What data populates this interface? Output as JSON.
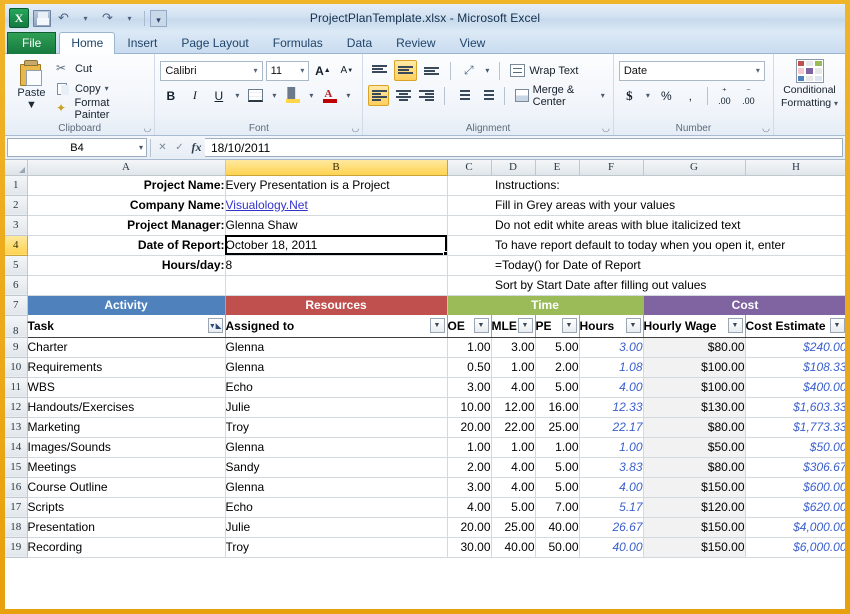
{
  "window": {
    "title": "ProjectPlanTemplate.xlsx - Microsoft Excel"
  },
  "quick_access": {
    "logo": "excel-logo",
    "items": [
      {
        "name": "save-icon",
        "label": "Save"
      },
      {
        "name": "undo-icon",
        "label": "↶"
      },
      {
        "name": "redo-icon",
        "label": "↷"
      },
      {
        "name": "customize-qat-icon",
        "label": "▼"
      }
    ]
  },
  "ribbon": {
    "tabs": [
      {
        "label": "File",
        "active": false,
        "file": true
      },
      {
        "label": "Home",
        "active": true
      },
      {
        "label": "Insert",
        "active": false
      },
      {
        "label": "Page Layout",
        "active": false
      },
      {
        "label": "Formulas",
        "active": false
      },
      {
        "label": "Data",
        "active": false
      },
      {
        "label": "Review",
        "active": false
      },
      {
        "label": "View",
        "active": false
      }
    ],
    "clipboard": {
      "group_label": "Clipboard",
      "paste": "Paste",
      "paste_caret": "▼",
      "cut": "Cut",
      "copy": "Copy",
      "format_painter": "Format Painter"
    },
    "font": {
      "group_label": "Font",
      "family": "Calibri",
      "size": "11",
      "grow": "A",
      "shrink": "A",
      "bold": "B",
      "italic": "I",
      "underline": "U",
      "borders": "Borders",
      "fill_color": "Fill Color",
      "font_color": "A",
      "caret": "▾"
    },
    "alignment": {
      "group_label": "Alignment",
      "top_align": "Top Align",
      "middle_align": "Middle Align",
      "bottom_align": "Bottom Align",
      "orientation": "Orientation",
      "wrap_text": "Wrap Text",
      "align_left": "Align Text Left",
      "align_center": "Center",
      "align_right": "Align Text Right",
      "decrease_indent": "Decrease Indent",
      "increase_indent": "Increase Indent",
      "merge_center": "Merge & Center",
      "caret": "▾"
    },
    "number": {
      "group_label": "Number",
      "format": "Date",
      "currency": "$",
      "percent": "%",
      "comma": ",",
      "increase_decimal": "Increase Decimal",
      "decrease_decimal": "Decrease Decimal",
      "caret": "▾"
    },
    "styles": {
      "conditional_formatting": "Conditional",
      "conditional_formatting2": "Formatting",
      "caret": "▾"
    }
  },
  "formula_bar": {
    "name_box": "B4",
    "caret": "▾",
    "cancel": "✕",
    "enter": "✓",
    "fx": "fx",
    "formula": "18/10/2011"
  },
  "grid": {
    "columns": [
      "A",
      "B",
      "C",
      "D",
      "E",
      "F",
      "G",
      "H"
    ],
    "selected_column": "B",
    "selected_row": "4",
    "selected_cell": "B4",
    "row_numbers": [
      "1",
      "2",
      "3",
      "4",
      "5",
      "6",
      "7",
      "8",
      "9",
      "10",
      "11",
      "12",
      "13",
      "14",
      "15",
      "16",
      "17",
      "18",
      "19"
    ]
  },
  "header_fields": [
    {
      "row": "1",
      "label": "Project Name:",
      "value": "Every Presentation is a Project",
      "style": "text"
    },
    {
      "row": "2",
      "label": "Company Name:",
      "value": "Visualology.Net",
      "style": "link"
    },
    {
      "row": "3",
      "label": "Project Manager:",
      "value": "Glenna Shaw",
      "style": "text"
    },
    {
      "row": "4",
      "label": "Date of Report:",
      "value": "October 18, 2011",
      "style": "selected"
    },
    {
      "row": "5",
      "label": "Hours/day:",
      "value": "8",
      "style": "text"
    }
  ],
  "instructions": {
    "title": "Instructions:",
    "lines": [
      "Fill in Grey areas with your values",
      "Do not edit white areas with blue italicized text",
      "To have report default to today when you open it, enter",
      "=Today() for Date of Report",
      "Sort by Start Date after filling out values"
    ]
  },
  "bands": [
    {
      "label": "Activity",
      "color": "#4F81BD",
      "key": "activity"
    },
    {
      "label": "Resources",
      "color": "#C0504D",
      "key": "resources"
    },
    {
      "label": "Time",
      "color": "#9BBB59",
      "key": "time"
    },
    {
      "label": "Cost",
      "color": "#8064A2",
      "key": "cost"
    }
  ],
  "table": {
    "headers": [
      {
        "label": "Task",
        "filter": "applied"
      },
      {
        "label": "Assigned to",
        "filter": "plain"
      },
      {
        "label": "OE",
        "filter": "plain"
      },
      {
        "label": "MLE",
        "filter": "plain"
      },
      {
        "label": "PE",
        "filter": "plain"
      },
      {
        "label": "Hours",
        "filter": "plain"
      },
      {
        "label": "Hourly Wage",
        "filter": "plain"
      },
      {
        "label": "Cost Estimate",
        "filter": "plain"
      }
    ],
    "rows": [
      {
        "row": "9",
        "task": "Charter",
        "assigned": "Glenna",
        "oe": "1.00",
        "mle": "3.00",
        "pe": "5.00",
        "hours": "3.00",
        "wage": "$80.00",
        "cost": "$240.00"
      },
      {
        "row": "10",
        "task": "Requirements",
        "assigned": "Glenna",
        "oe": "0.50",
        "mle": "1.00",
        "pe": "2.00",
        "hours": "1.08",
        "wage": "$100.00",
        "cost": "$108.33"
      },
      {
        "row": "11",
        "task": "WBS",
        "assigned": "Echo",
        "oe": "3.00",
        "mle": "4.00",
        "pe": "5.00",
        "hours": "4.00",
        "wage": "$100.00",
        "cost": "$400.00"
      },
      {
        "row": "12",
        "task": "Handouts/Exercises",
        "assigned": "Julie",
        "oe": "10.00",
        "mle": "12.00",
        "pe": "16.00",
        "hours": "12.33",
        "wage": "$130.00",
        "cost": "$1,603.33"
      },
      {
        "row": "13",
        "task": "Marketing",
        "assigned": "Troy",
        "oe": "20.00",
        "mle": "22.00",
        "pe": "25.00",
        "hours": "22.17",
        "wage": "$80.00",
        "cost": "$1,773.33"
      },
      {
        "row": "14",
        "task": "Images/Sounds",
        "assigned": "Glenna",
        "oe": "1.00",
        "mle": "1.00",
        "pe": "1.00",
        "hours": "1.00",
        "wage": "$50.00",
        "cost": "$50.00"
      },
      {
        "row": "15",
        "task": "Meetings",
        "assigned": "Sandy",
        "oe": "2.00",
        "mle": "4.00",
        "pe": "5.00",
        "hours": "3.83",
        "wage": "$80.00",
        "cost": "$306.67"
      },
      {
        "row": "16",
        "task": "Course Outline",
        "assigned": "Glenna",
        "oe": "3.00",
        "mle": "4.00",
        "pe": "5.00",
        "hours": "4.00",
        "wage": "$150.00",
        "cost": "$600.00"
      },
      {
        "row": "17",
        "task": "Scripts",
        "assigned": "Echo",
        "oe": "4.00",
        "mle": "5.00",
        "pe": "7.00",
        "hours": "5.17",
        "wage": "$120.00",
        "cost": "$620.00"
      },
      {
        "row": "18",
        "task": "Presentation",
        "assigned": "Julie",
        "oe": "20.00",
        "mle": "25.00",
        "pe": "40.00",
        "hours": "26.67",
        "wage": "$150.00",
        "cost": "$4,000.00"
      },
      {
        "row": "19",
        "task": "Recording",
        "assigned": "Troy",
        "oe": "30.00",
        "mle": "40.00",
        "pe": "50.00",
        "hours": "40.00",
        "wage": "$150.00",
        "cost": "$6,000.00"
      }
    ]
  },
  "colors": {
    "window_frame": "#E8A00C",
    "activity": "#4F81BD",
    "resources": "#C0504D",
    "time": "#9BBB59",
    "cost": "#8064A2",
    "hyperlink": "#3333CC",
    "calculated_text": "#3A5FCD",
    "selection": "#FFD351"
  }
}
